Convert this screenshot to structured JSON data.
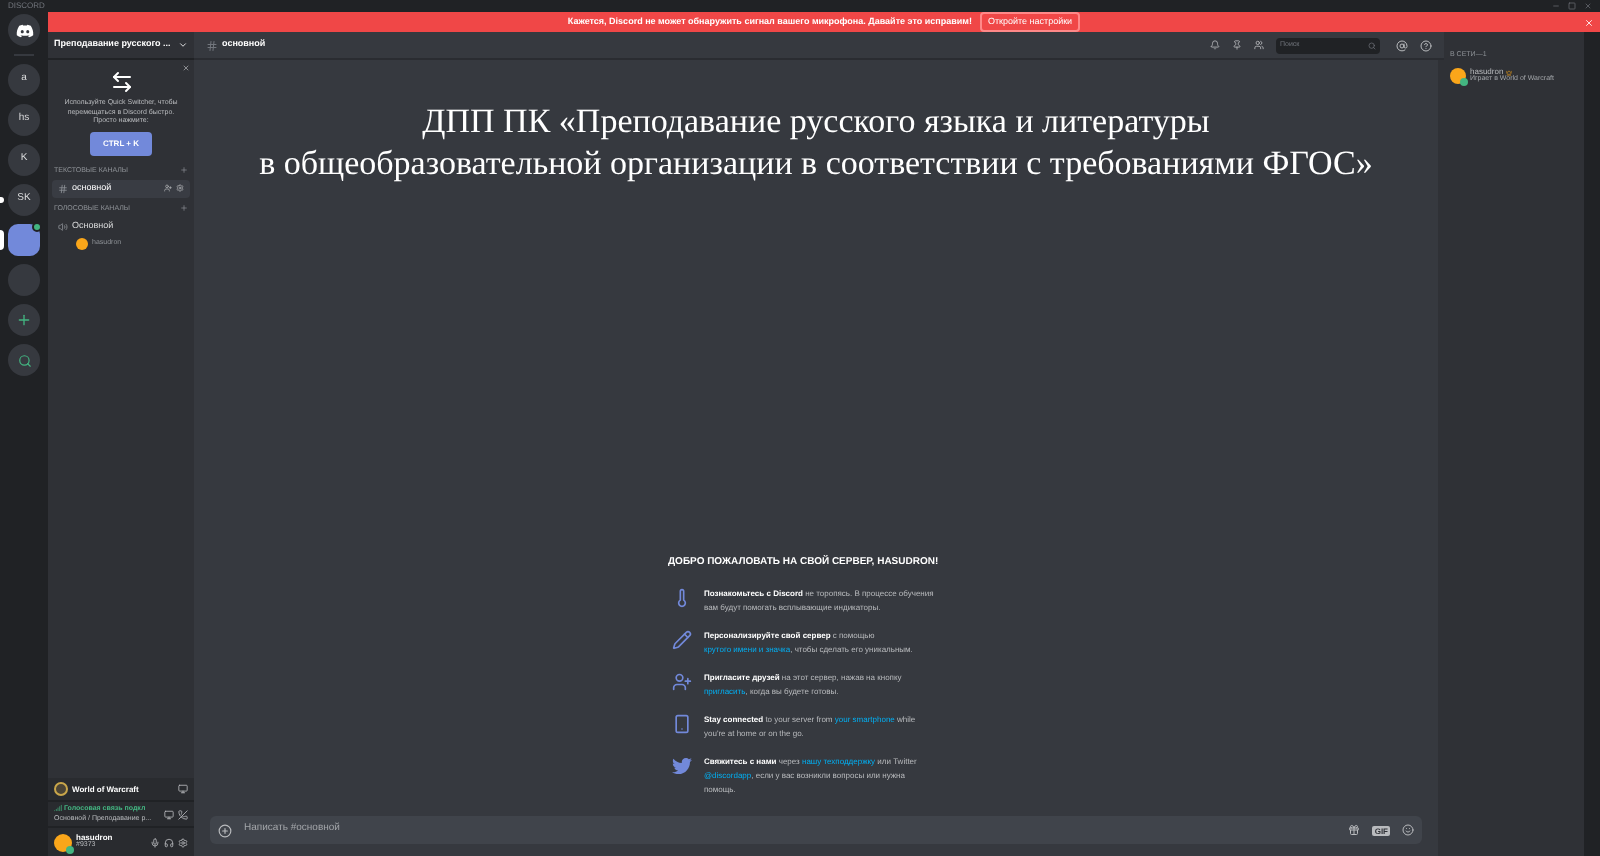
{
  "window": {
    "title": "DISCORD"
  },
  "servers": [
    {
      "label": "a",
      "selected": false,
      "unread": false
    },
    {
      "label": "hs",
      "selected": false,
      "unread": false
    },
    {
      "label": "K",
      "selected": false,
      "unread": false
    },
    {
      "label": "SK",
      "selected": false,
      "unread": true
    },
    {
      "selected": true,
      "badge": true
    },
    {
      "selected": false,
      "unread": false
    }
  ],
  "banner": {
    "message": "Кажется, Discord не может обнаружить сигнал вашего микрофона. Давайте это исправим!",
    "button": "Откройте настройки"
  },
  "server_name": "Преподавание русского ...",
  "quick_switcher": {
    "text": "Используйте Quick Switcher, чтобы перемещаться в Discord быстро. Просто нажмите:",
    "shortcut": "CTRL + K"
  },
  "categories": [
    {
      "name": "ТЕКСТОВЫЕ КАНАЛЫ",
      "kind": "text",
      "channels": [
        {
          "name": "основной",
          "selected": true
        }
      ]
    },
    {
      "name": "ГОЛОСОВЫЕ КАНАЛЫ",
      "kind": "voice",
      "channels": [
        {
          "name": "Основной",
          "selected": false,
          "members": [
            "hasudron"
          ]
        }
      ]
    }
  ],
  "activity": {
    "game": "World of Warcraft"
  },
  "voice_status": {
    "title": "Голосовая связь подкл",
    "detail": "Основной / Преподавание р..."
  },
  "user": {
    "name": "hasudron",
    "tag": "#9373",
    "online": true
  },
  "channel_header": {
    "name": "основной",
    "search_placeholder": "Поиск"
  },
  "announcement": [
    "ДПП ПК «Преподавание русского языка и литературы",
    "в общеобразовательной организации в соответствии с требованиями ФГОС»"
  ],
  "welcome": {
    "title": "ДОБРО ПОЖАЛОВАТЬ НА СВОЙ СЕРВЕР, HASUDRON!",
    "items": [
      {
        "kind": "learn",
        "parts": [
          {
            "kind": "bold",
            "text": "Познакомьтесь с Discord"
          },
          {
            "kind": "text",
            "text": " не торопясь. В процессе обучения вам будут помогать всплывающие индикаторы."
          }
        ]
      },
      {
        "kind": "personalize",
        "parts": [
          {
            "kind": "bold",
            "text": "Персонализируйте свой сервер"
          },
          {
            "kind": "text",
            "text": " с помощью "
          },
          {
            "kind": "link",
            "text": "крутого имени и значка"
          },
          {
            "kind": "text",
            "text": ", чтобы сделать его уникальным."
          }
        ]
      },
      {
        "kind": "invite",
        "parts": [
          {
            "kind": "bold",
            "text": "Пригласите друзей"
          },
          {
            "kind": "text",
            "text": " на этот сервер, нажав на кнопку "
          },
          {
            "kind": "link",
            "text": "пригласить"
          },
          {
            "kind": "text",
            "text": ", когда вы будете готовы."
          }
        ]
      },
      {
        "kind": "mobile",
        "parts": [
          {
            "kind": "bold",
            "text": "Stay connected"
          },
          {
            "kind": "text",
            "text": " to your server from "
          },
          {
            "kind": "link",
            "text": "your smartphone"
          },
          {
            "kind": "text",
            "text": " while you're at home or on the go."
          }
        ]
      },
      {
        "kind": "contact",
        "parts": [
          {
            "kind": "bold",
            "text": "Свяжитесь с нами"
          },
          {
            "kind": "text",
            "text": " через "
          },
          {
            "kind": "link",
            "text": "нашу техподдержку"
          },
          {
            "kind": "text",
            "text": " или Twitter "
          },
          {
            "kind": "link",
            "text": "@discordapp"
          },
          {
            "kind": "text",
            "text": ", если у вас возникли вопросы или нужна помощь."
          }
        ]
      }
    ]
  },
  "composer": {
    "placeholder": "Написать #основной",
    "gif": "GIF"
  },
  "members": {
    "heading": "В СЕТИ—1",
    "list": [
      {
        "name": "hasudron",
        "owner": true,
        "activity": "Играет в World of Warcraft",
        "online": true
      }
    ]
  }
}
